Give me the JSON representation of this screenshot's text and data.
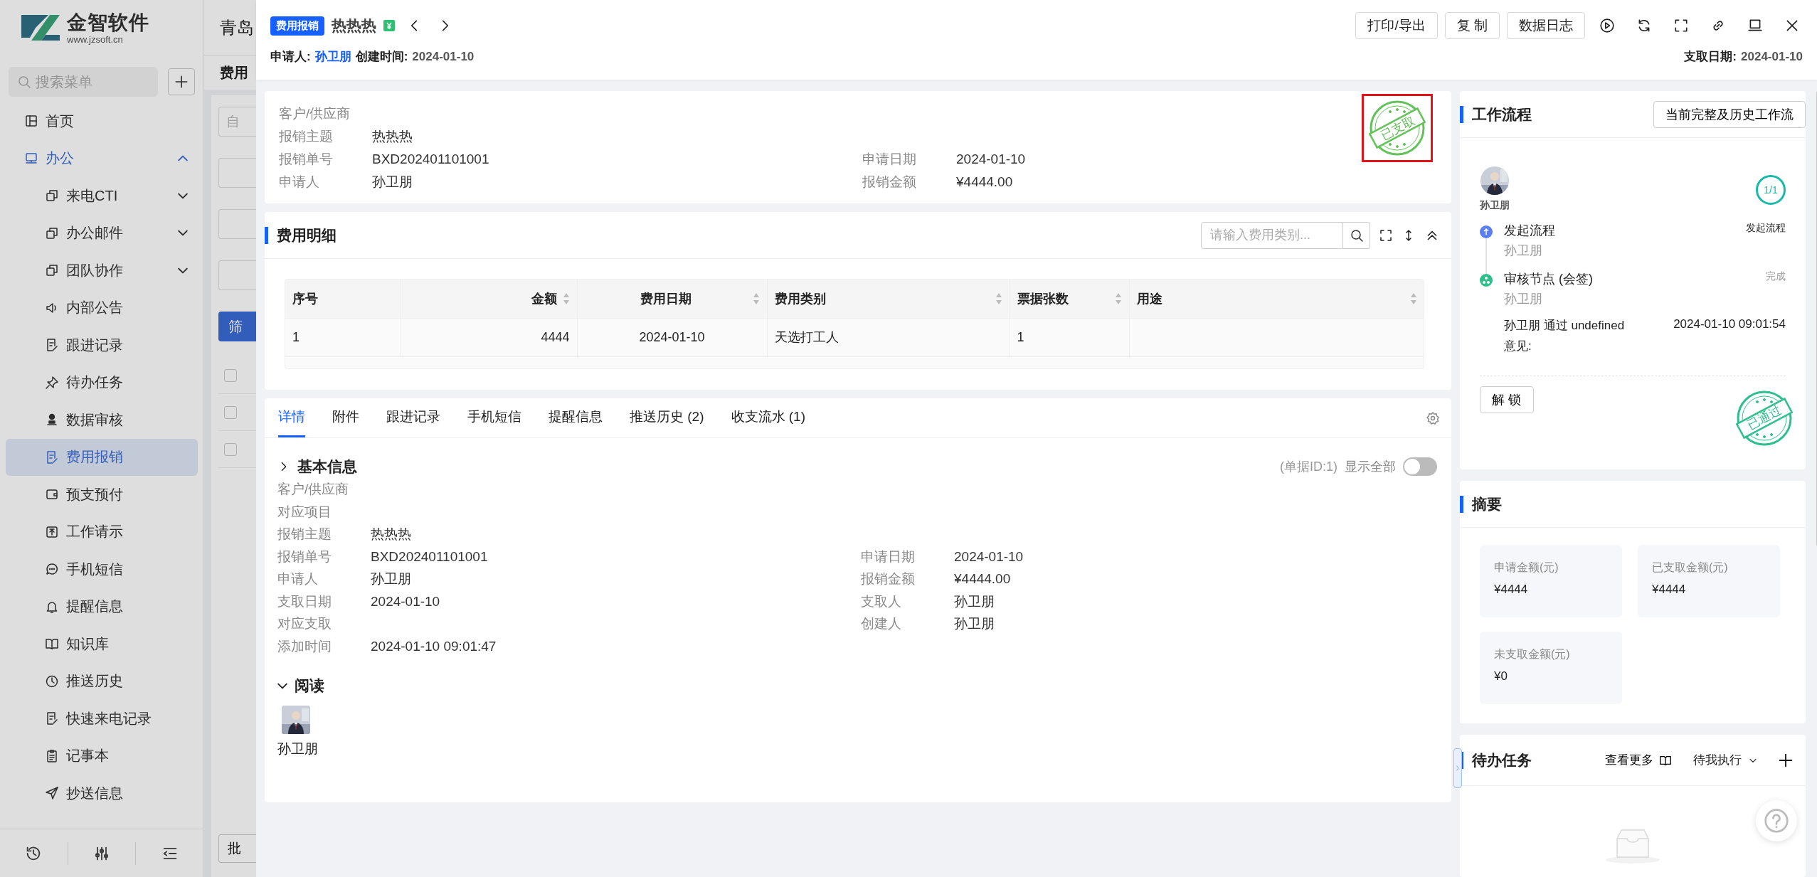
{
  "sidebar": {
    "logo_name": "金智软件",
    "logo_url": "www.jzsoft.cn",
    "search_placeholder": "搜索菜单",
    "items": [
      {
        "label": "首页",
        "kind": "link",
        "selected": false
      },
      {
        "label": "办公",
        "kind": "group",
        "selected": false,
        "expanded": true,
        "children": [
          {
            "label": "来电CTI",
            "kind": "group",
            "selected": false,
            "expanded": false
          },
          {
            "label": "办公邮件",
            "kind": "group",
            "selected": false,
            "expanded": false
          },
          {
            "label": "团队协作",
            "kind": "group",
            "selected": false,
            "expanded": false
          },
          {
            "label": "内部公告",
            "kind": "link",
            "selected": false
          },
          {
            "label": "跟进记录",
            "kind": "link",
            "selected": false
          },
          {
            "label": "待办任务",
            "kind": "link",
            "selected": false
          },
          {
            "label": "数据审核",
            "kind": "link",
            "selected": false
          },
          {
            "label": "费用报销",
            "kind": "link",
            "selected": true
          },
          {
            "label": "预支预付",
            "kind": "link",
            "selected": false
          },
          {
            "label": "工作请示",
            "kind": "link",
            "selected": false
          },
          {
            "label": "手机短信",
            "kind": "link",
            "selected": false
          },
          {
            "label": "提醒信息",
            "kind": "link",
            "selected": false
          },
          {
            "label": "知识库",
            "kind": "link",
            "selected": false
          },
          {
            "label": "推送历史",
            "kind": "link",
            "selected": false
          },
          {
            "label": "快速来电记录",
            "kind": "link",
            "selected": false
          },
          {
            "label": "记事本",
            "kind": "link",
            "selected": false
          },
          {
            "label": "抄送信息",
            "kind": "link",
            "selected": false
          }
        ]
      }
    ]
  },
  "background_page": {
    "title": "青岛",
    "heading": "费用",
    "filter_placeholder": "自",
    "filter_button": "筛",
    "batch_button": "批",
    "rows": [
      {
        "checked": false
      },
      {
        "checked": false
      },
      {
        "checked": false
      }
    ]
  },
  "drawer": {
    "type_badge": "费用报销",
    "title": "热热热",
    "buttons": [
      "打印/导出",
      "复 制",
      "数据日志"
    ],
    "applicant_label": "申请人:",
    "applicant": "孙卫朋",
    "created_label": "创建时间:",
    "created": "2024-01-10",
    "paid_label": "支取日期:",
    "paid": "2024-01-10"
  },
  "summary_card": {
    "stamp": {
      "text": "已支取",
      "highlighted": true
    },
    "rows": [
      [
        {
          "label": "客户/供应商"
        }
      ],
      [
        {
          "label": "报销主题",
          "value": "热热热"
        }
      ],
      [
        {
          "label": "报销单号",
          "value": "BXD202401101001"
        },
        {
          "label": "申请日期",
          "value": "2024-01-10"
        }
      ],
      [
        {
          "label": "申请人",
          "value": "孙卫朋"
        },
        {
          "label": "报销金额",
          "value": "¥4444.00"
        }
      ]
    ]
  },
  "expense_details": {
    "title": "费用明细",
    "search_placeholder": "请输入费用类别...",
    "columns": [
      {
        "label": "序号",
        "sortable": false
      },
      {
        "label": "金额",
        "sortable": true
      },
      {
        "label": "费用日期",
        "sortable": true
      },
      {
        "label": "费用类别",
        "sortable": true
      },
      {
        "label": "票据张数",
        "sortable": true
      },
      {
        "label": "用途",
        "sortable": true
      }
    ],
    "rows": [
      [
        "1",
        "4444",
        "2024-01-10",
        "天选打工人",
        "1"
      ]
    ]
  },
  "tabs": [
    {
      "label": "详情",
      "selected": true
    },
    {
      "label": "附件",
      "selected": false
    },
    {
      "label": "跟进记录",
      "selected": false
    },
    {
      "label": "手机短信",
      "selected": false
    },
    {
      "label": "提醒信息",
      "selected": false
    },
    {
      "label": "推送历史 (2)",
      "selected": false
    },
    {
      "label": "收支流水 (1)",
      "selected": false
    }
  ],
  "basic_info": {
    "title": "基本信息",
    "doc_id": "(单据ID:1)",
    "show_all_label": "显示全部",
    "show_all": false,
    "rows": [
      [
        {
          "label": "客户/供应商"
        }
      ],
      [
        {
          "label": "对应项目"
        }
      ],
      [
        {
          "label": "报销主题",
          "value": "热热热"
        }
      ],
      [
        {
          "label": "报销单号",
          "value": "BXD202401101001"
        },
        {
          "label": "申请日期",
          "value": "2024-01-10"
        }
      ],
      [
        {
          "label": "申请人",
          "value": "孙卫朋"
        },
        {
          "label": "报销金额",
          "value": "¥4444.00"
        }
      ],
      [
        {
          "label": "支取日期",
          "value": "2024-01-10"
        },
        {
          "label": "支取人",
          "value": "孙卫朋"
        }
      ],
      [
        {
          "label": "对应支取"
        },
        {
          "label": "创建人",
          "value": "孙卫朋"
        }
      ],
      [
        {
          "label": "添加时间",
          "value": "2024-01-10 09:01:47"
        }
      ]
    ]
  },
  "read_section": {
    "title": "阅读",
    "readers": [
      {
        "name": "孙卫朋"
      }
    ]
  },
  "workflow": {
    "title": "工作流程",
    "history_button": "当前完整及历史工作流",
    "initiator": "孙卫朋",
    "progress": "1/1",
    "steps": [
      {
        "kind": "start",
        "title": "发起流程",
        "person": "孙卫朋",
        "status": "发起流程"
      },
      {
        "kind": "review",
        "title": "审核节点 (会签)",
        "person": "孙卫朋",
        "status": "完成"
      }
    ],
    "log": "孙卫朋 通过 undefined",
    "log_time": "2024-01-10 09:01:54",
    "opinion_label": "意见:",
    "stamp": "已通过",
    "unlock_button": "解 锁"
  },
  "summary": {
    "title": "摘要",
    "tiles": [
      {
        "label": "申请金额(元)",
        "value": "¥4444"
      },
      {
        "label": "已支取金额(元)",
        "value": "¥4444"
      },
      {
        "label": "未支取金额(元)",
        "value": "¥0"
      }
    ]
  },
  "todo": {
    "title": "待办任务",
    "more": "查看更多",
    "filter": "待我执行"
  }
}
